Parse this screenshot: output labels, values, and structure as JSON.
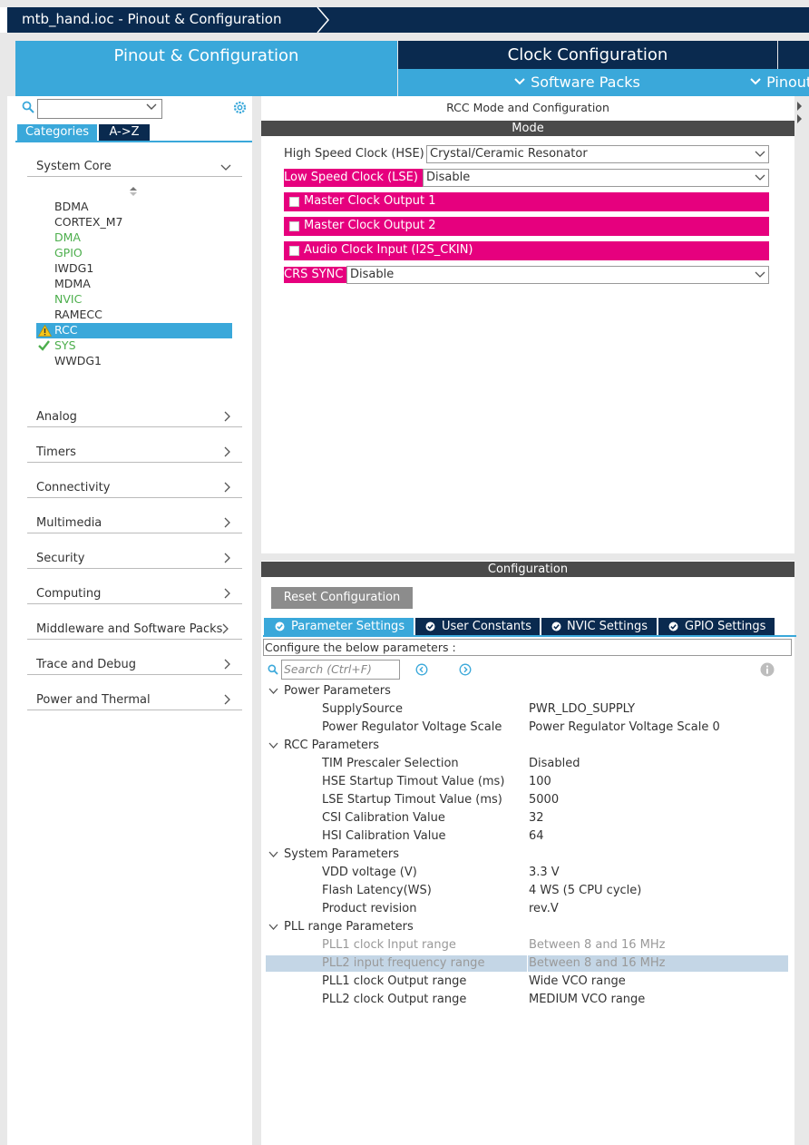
{
  "breadcrumb": {
    "file": "mtb_hand.ioc - Pinout & Configuration"
  },
  "tabs": {
    "pinout": "Pinout & Configuration",
    "clock": "Clock Configuration",
    "software_packs": "Software Packs",
    "pinout_view": "Pinout"
  },
  "left": {
    "search_value": "",
    "view_tabs": [
      "Categories",
      "A->Z"
    ],
    "system_core": "System Core",
    "peripherals": [
      {
        "name": "BDMA",
        "state": "normal"
      },
      {
        "name": "CORTEX_M7",
        "state": "normal"
      },
      {
        "name": "DMA",
        "state": "configured"
      },
      {
        "name": "GPIO",
        "state": "configured"
      },
      {
        "name": "IWDG1",
        "state": "normal"
      },
      {
        "name": "MDMA",
        "state": "normal"
      },
      {
        "name": "NVIC",
        "state": "configured"
      },
      {
        "name": "RAMECC",
        "state": "normal"
      },
      {
        "name": "RCC",
        "state": "warning"
      },
      {
        "name": "SYS",
        "state": "ok"
      },
      {
        "name": "WWDG1",
        "state": "normal"
      }
    ],
    "categories": [
      "Analog",
      "Timers",
      "Connectivity",
      "Multimedia",
      "Security",
      "Computing",
      "Middleware and Software Packs",
      "Trace and Debug",
      "Power and Thermal"
    ]
  },
  "mode": {
    "title": "RCC Mode and Configuration",
    "header": "Mode",
    "hse_label": "High Speed Clock (HSE)",
    "hse_value": "Crystal/Ceramic Resonator",
    "lse_label": "Low Speed Clock (LSE)",
    "lse_value": "Disable",
    "mco1": "Master Clock Output 1",
    "mco2": "Master Clock Output 2",
    "i2s": "Audio Clock Input (I2S_CKIN)",
    "crs_label": "CRS SYNC",
    "crs_value": "Disable"
  },
  "config": {
    "header": "Configuration",
    "reset": "Reset Configuration",
    "tabs": [
      "Parameter Settings",
      "User Constants",
      "NVIC Settings",
      "GPIO Settings"
    ],
    "hint": "Configure the below parameters :",
    "search_placeholder": "Search (Ctrl+F)",
    "groups": [
      {
        "name": "Power Parameters",
        "params": [
          {
            "name": "SupplySource",
            "value": "PWR_LDO_SUPPLY"
          },
          {
            "name": "Power Regulator Voltage Scale",
            "value": "Power Regulator Voltage Scale 0"
          }
        ]
      },
      {
        "name": "RCC Parameters",
        "params": [
          {
            "name": "TIM Prescaler Selection",
            "value": "Disabled"
          },
          {
            "name": "HSE Startup Timout Value (ms)",
            "value": "100"
          },
          {
            "name": "LSE Startup Timout Value (ms)",
            "value": "5000"
          },
          {
            "name": "CSI Calibration Value",
            "value": "32"
          },
          {
            "name": "HSI Calibration Value",
            "value": "64"
          }
        ]
      },
      {
        "name": "System Parameters",
        "params": [
          {
            "name": "VDD voltage (V)",
            "value": "3.3 V"
          },
          {
            "name": "Flash Latency(WS)",
            "value": "4 WS (5 CPU cycle)"
          },
          {
            "name": "Product revision",
            "value": "rev.V"
          }
        ]
      },
      {
        "name": "PLL range Parameters",
        "params": [
          {
            "name": "PLL1 clock Input range",
            "value": "Between 8 and 16 MHz"
          },
          {
            "name": "PLL2 input frequency range",
            "value": "Between 8 and 16 MHz"
          },
          {
            "name": "PLL1 clock Output range",
            "value": "Wide VCO range"
          },
          {
            "name": "PLL2 clock Output range",
            "value": "MEDIUM VCO range"
          }
        ]
      }
    ]
  },
  "colors": {
    "navy": "#0a2a4f",
    "accent": "#3aa8da",
    "pink": "#e6007e",
    "configured_green": "#4cae4c",
    "selected_row": "#c4d6e6"
  }
}
